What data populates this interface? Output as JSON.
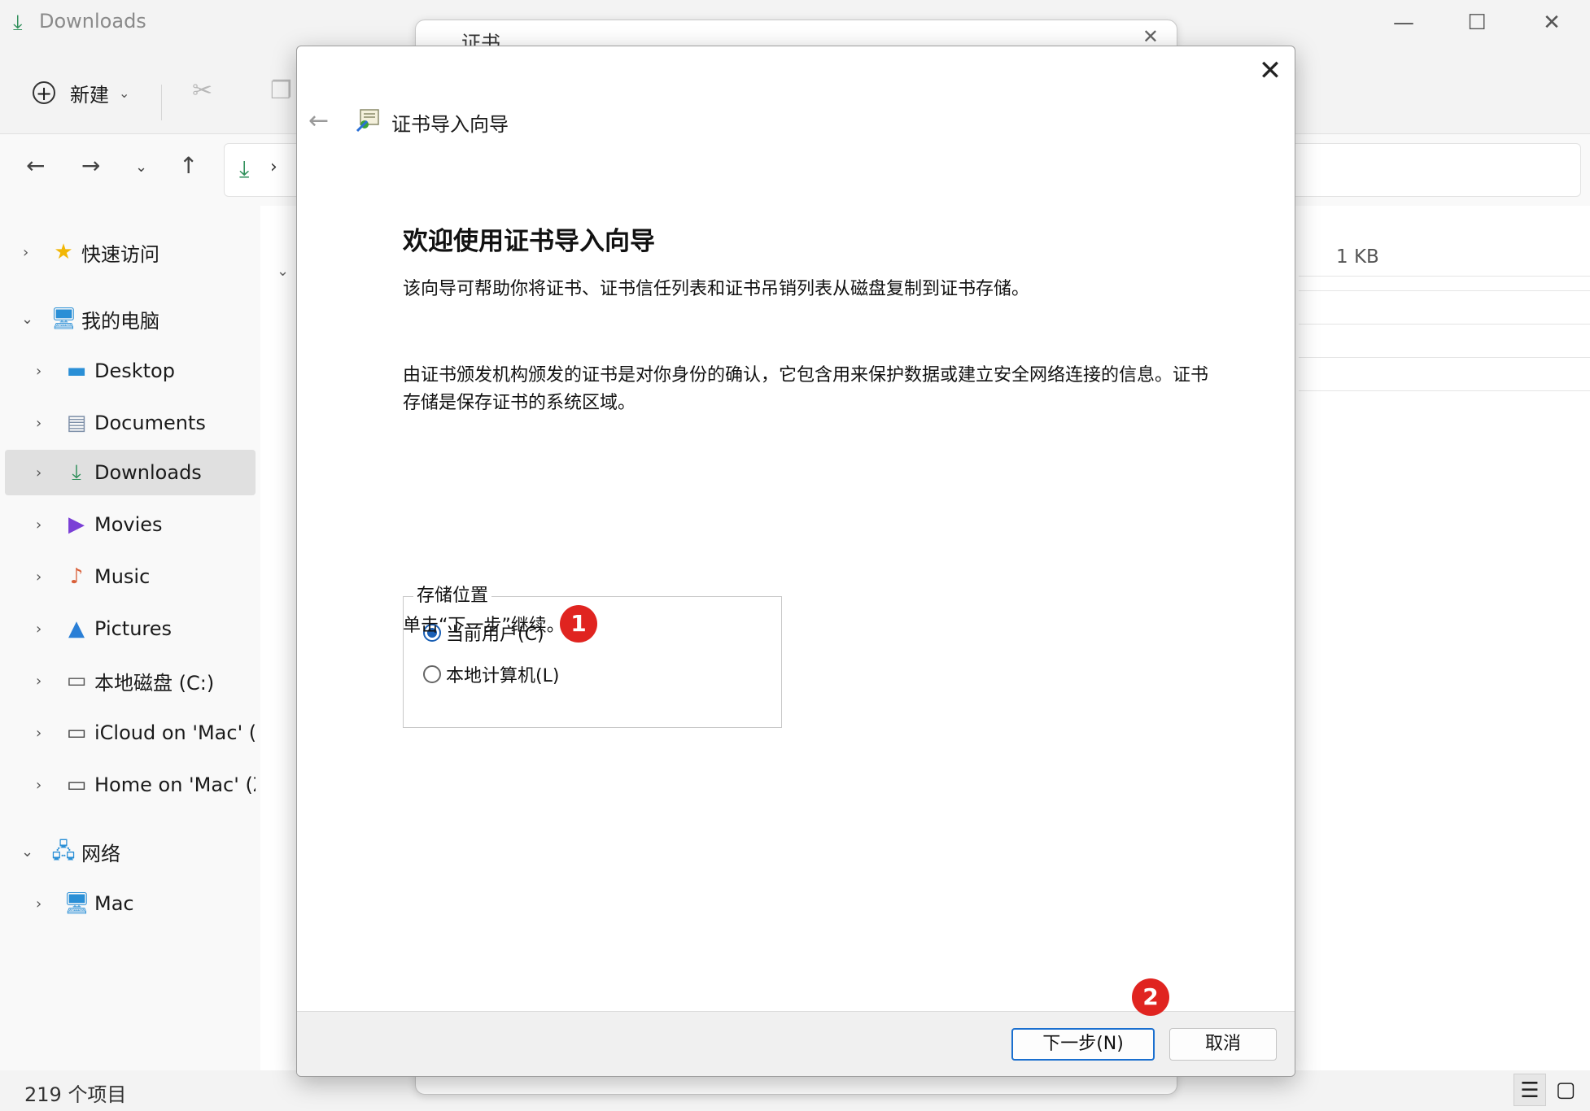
{
  "explorer": {
    "title": "Downloads",
    "toolbar": {
      "new_label": "新建"
    },
    "nav": {
      "items": [
        {
          "label": "快速访问"
        },
        {
          "label": "我的电脑"
        },
        {
          "label": "Desktop"
        },
        {
          "label": "Documents"
        },
        {
          "label": "Downloads"
        },
        {
          "label": "Movies"
        },
        {
          "label": "Music"
        },
        {
          "label": "Pictures"
        },
        {
          "label": "本地磁盘 (C:)"
        },
        {
          "label": "iCloud on 'Mac' (Y"
        },
        {
          "label": "Home on 'Mac' (Z"
        },
        {
          "label": "网络"
        },
        {
          "label": "Mac"
        }
      ]
    },
    "content": {
      "file_size": "1 KB"
    },
    "status": {
      "count": "219 个项目"
    }
  },
  "background_dialog": {
    "title": "证书"
  },
  "wizard": {
    "title": "证书导入向导",
    "heading": "欢迎使用证书导入向导",
    "para1": "该向导可帮助你将证书、证书信任列表和证书吊销列表从磁盘复制到证书存储。",
    "para2": "由证书颁发机构颁发的证书是对你身份的确认，它包含用来保护数据或建立安全网络连接的信息。证书存储是保存证书的系统区域。",
    "store_group": {
      "label": "存储位置",
      "options": [
        {
          "label": "当前用户(C)",
          "checked": true
        },
        {
          "label": "本地计算机(L)",
          "checked": false
        }
      ]
    },
    "instruction": "单击“下一步”继续。",
    "buttons": {
      "next": "下一步(N)",
      "cancel": "取消"
    }
  },
  "annotations": {
    "badge1": "1",
    "badge2": "2",
    "color": "#e02420"
  }
}
